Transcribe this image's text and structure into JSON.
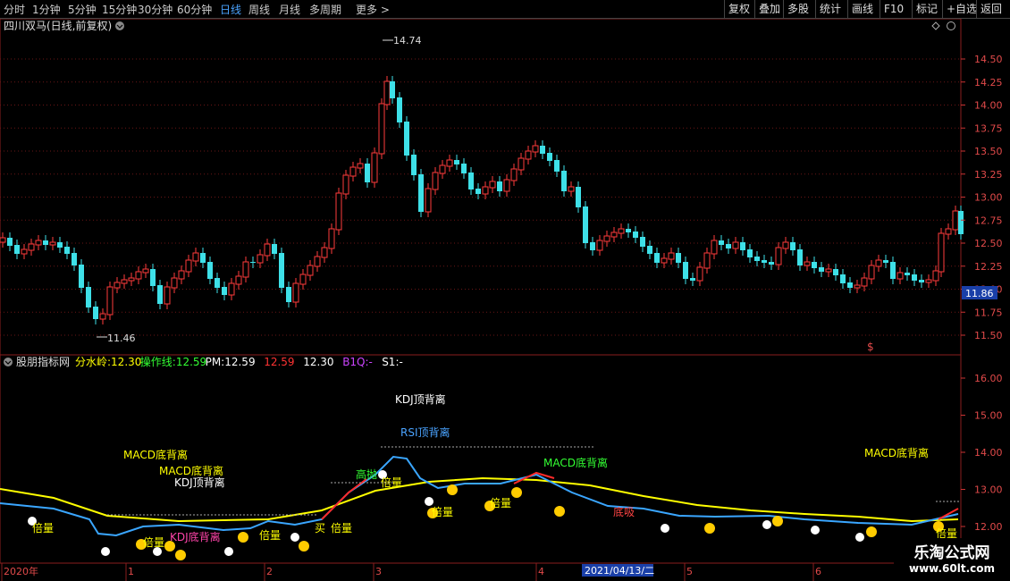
{
  "toolbar": {
    "timeframes": [
      "分时",
      "1分钟",
      "5分钟",
      "15分钟",
      "30分钟",
      "60分钟",
      "日线",
      "周线",
      "月线",
      "多周期",
      "更多 >"
    ],
    "active": "日线",
    "right_buttons": [
      "复权",
      "叠加",
      "多股",
      "统计",
      "画线",
      "F10",
      "标记",
      "+自选",
      "返回"
    ]
  },
  "main_chart": {
    "title": "四川双马(日线,前复权)",
    "high_label": "14.74",
    "low_label": "11.46",
    "price_ticks": [
      "14.50",
      "14.25",
      "14.00",
      "13.75",
      "13.50",
      "13.25",
      "13.00",
      "12.75",
      "12.50",
      "12.25",
      "12.00",
      "11.75",
      "11.50"
    ],
    "current_price": "11.86",
    "dollar_marker": "$"
  },
  "indicator": {
    "name": "股朋指标网",
    "fields": [
      {
        "label": "分水岭:",
        "value": "12.30",
        "color": "#ffff00"
      },
      {
        "label": "操作线:",
        "value": "12.59",
        "color": "#33ff33"
      },
      {
        "label": "PM:",
        "value": "12.59",
        "color": "#ffffff"
      },
      {
        "label": "",
        "value": "12.59",
        "color": "#ff3333"
      },
      {
        "label": "",
        "value": "12.30",
        "color": "#ffffff"
      },
      {
        "label": "B1Q:",
        "value": "-",
        "color": "#cc44ff"
      },
      {
        "label": "S1:",
        "value": "-",
        "color": "#ffffff"
      }
    ],
    "ticks": [
      "16.00",
      "15.00",
      "14.00",
      "13.00",
      "12.00"
    ],
    "annotations": {
      "kdj_top": "KDJ顶背离",
      "rsi_top": "RSI顶背离",
      "macd_bottom": "MACD底背离",
      "macd_bottom2": "MACD底背离",
      "kdj_top2": "KDJ顶背离",
      "macd_right": "MACD底背离",
      "macd_green": "MACD底背离",
      "gaopao": "高抛",
      "beiliang": "倍量",
      "diki": "底吸",
      "kdj_bottom": "KDJ底背离",
      "mai": "买"
    }
  },
  "time_axis": {
    "labels": [
      "2020年",
      "1",
      "2",
      "3",
      "4",
      "5",
      "6"
    ],
    "cursor_date": "2021/04/13/二"
  },
  "watermark": {
    "line1": "乐淘公式网",
    "line2": "www.60lt.com"
  },
  "colors": {
    "up": "#ff3b3b",
    "down": "#3ee0e8",
    "grid": "#8a1e1e",
    "fen": "#ffff00",
    "cao": "#33ff33"
  }
}
